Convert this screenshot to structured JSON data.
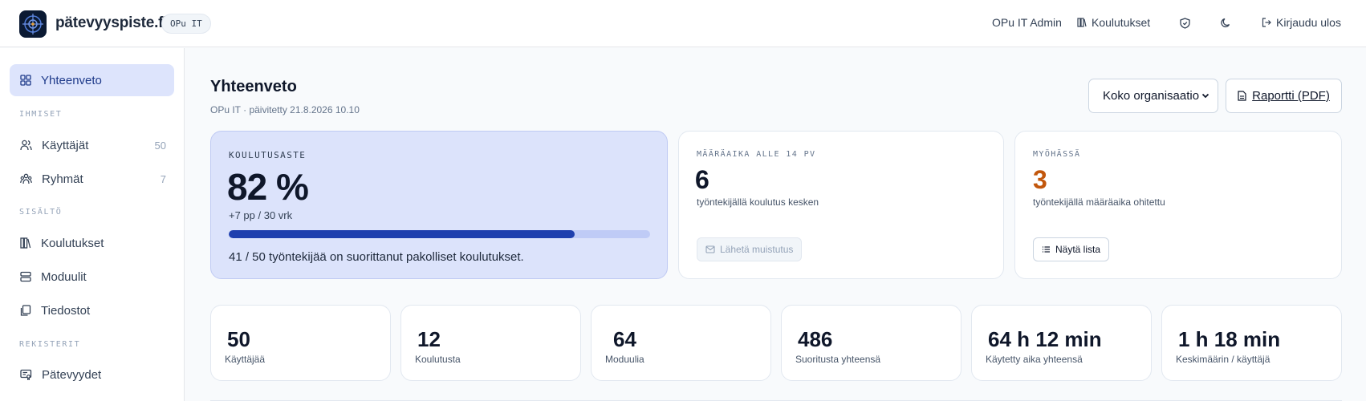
{
  "app": {
    "brand": "pätevyyspiste.fi",
    "org_pill": "OPu IT"
  },
  "topnav": {
    "user": "OPu IT Admin",
    "courses": "Koulutukset",
    "logout": "Kirjaudu ulos"
  },
  "sidebar": {
    "overview": "Yhteenveto",
    "sections": {
      "people": "IHMISET",
      "content": "SISÄLTÖ",
      "registers": "REKISTERIT"
    },
    "items": {
      "users": {
        "label": "Käyttäjät",
        "count": "50"
      },
      "groups": {
        "label": "Ryhmät",
        "count": "7"
      },
      "courses": {
        "label": "Koulutukset"
      },
      "modules": {
        "label": "Moduulit"
      },
      "files": {
        "label": "Tiedostot"
      },
      "competencies": {
        "label": "Pätevyydet"
      }
    }
  },
  "main": {
    "title": "Yhteenveto",
    "subtitle": "OPu IT · päivitetty 21.8.2026 10.10",
    "scope_select": "Koko organisaatio",
    "report_button": "Raportti (PDF)"
  },
  "cards": {
    "training_rate": {
      "label": "KOULUTUSASTE",
      "value": "82 %",
      "change": "+7 pp / 30 vrk",
      "progress": 0.82,
      "note": "41 / 50 työntekijää on suorittanut pakolliset koulutukset."
    },
    "deadline": {
      "label": "MÄÄRÄAIKA ALLE 14 PV",
      "value": "6",
      "desc": "työntekijällä koulutus kesken",
      "button": "Lähetä muistutus"
    },
    "overdue": {
      "label": "MYÖHÄSSÄ",
      "value": "3",
      "desc": "työntekijällä määräaika ohitettu",
      "button": "Näytä lista",
      "color": "#c2570c"
    }
  },
  "stats": [
    {
      "value": "50",
      "label": "Käyttäjää"
    },
    {
      "value": "12",
      "label": "Koulutusta"
    },
    {
      "value": "64",
      "label": "Moduulia"
    },
    {
      "value": "486",
      "label": "Suoritusta yhteensä"
    },
    {
      "value": "64 h 12 min",
      "label": "Käytetty aika yhteensä"
    },
    {
      "value": "1 h 18 min",
      "label": "Keskimäärin / käyttäjä"
    }
  ],
  "colors": {
    "accent": "#1e3fae",
    "hero_bg": "#dce3fb",
    "active_nav_bg": "#dde4fc"
  }
}
